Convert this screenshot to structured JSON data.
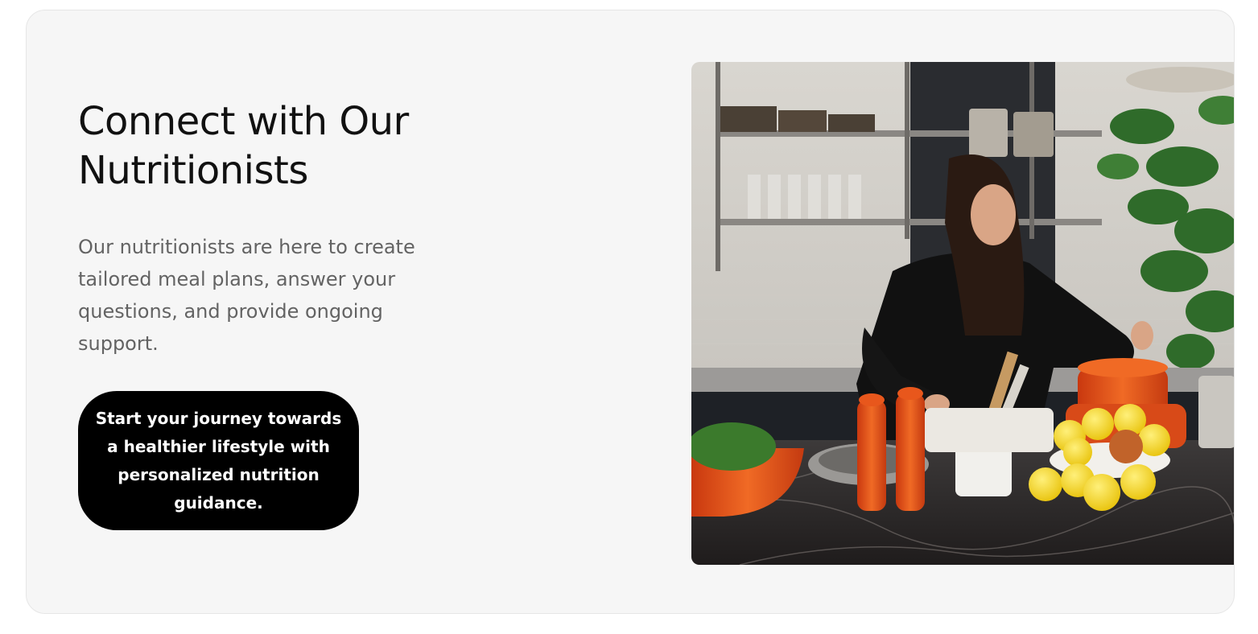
{
  "section": {
    "title": "Connect with Our Nutritionists",
    "description": "Our nutritionists are here to create tailored meal plans, answer your questions, and provide ongoing support.",
    "cta_label": "Start your journey towards a healthier lifestyle with personalized nutrition guidance."
  },
  "image": {
    "subject": "kitchen-nutritionist-photo"
  },
  "colors": {
    "card_bg": "#f6f6f6",
    "title": "#111111",
    "body_text": "#636363",
    "button_bg": "#000000",
    "button_text": "#ffffff",
    "accent_orange": "#e8571c",
    "lemon_yellow": "#f5d10f"
  }
}
